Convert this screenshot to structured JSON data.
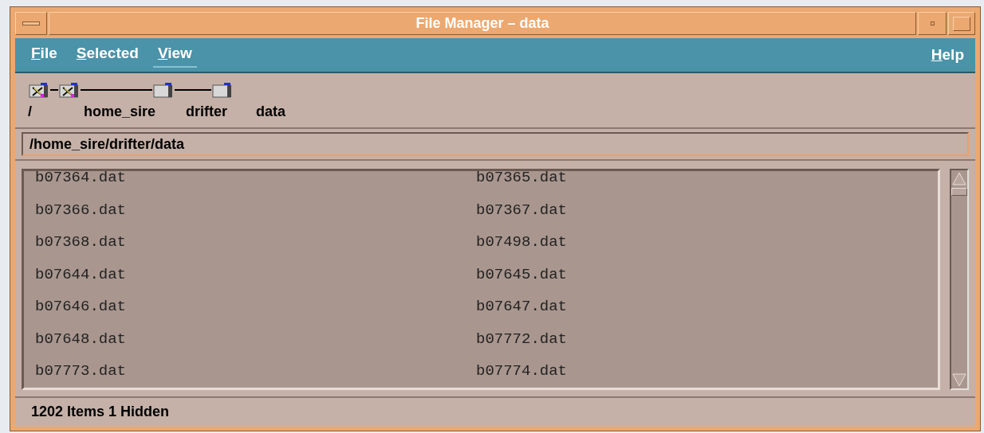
{
  "window": {
    "title": "File Manager – data"
  },
  "menu": [
    {
      "label": "File",
      "selected": false
    },
    {
      "label": "Selected",
      "selected": false
    },
    {
      "label": "View",
      "selected": true
    }
  ],
  "help_menu": {
    "label": "Help"
  },
  "path_tree": [
    {
      "label": "/",
      "kind": "locked"
    },
    {
      "label": "home_sire",
      "kind": "locked"
    },
    {
      "label": "drifter",
      "kind": "folder"
    },
    {
      "label": "data",
      "kind": "folder"
    }
  ],
  "path_field": {
    "value": "/home_sire/drifter/data"
  },
  "files": [
    [
      "b07364.dat",
      "b07365.dat"
    ],
    [
      "b07366.dat",
      "b07367.dat"
    ],
    [
      "b07368.dat",
      "b07498.dat"
    ],
    [
      "b07644.dat",
      "b07645.dat"
    ],
    [
      "b07646.dat",
      "b07647.dat"
    ],
    [
      "b07648.dat",
      "b07772.dat"
    ],
    [
      "b07773.dat",
      "b07774.dat"
    ]
  ],
  "status_bar": "1202 Items 1 Hidden"
}
